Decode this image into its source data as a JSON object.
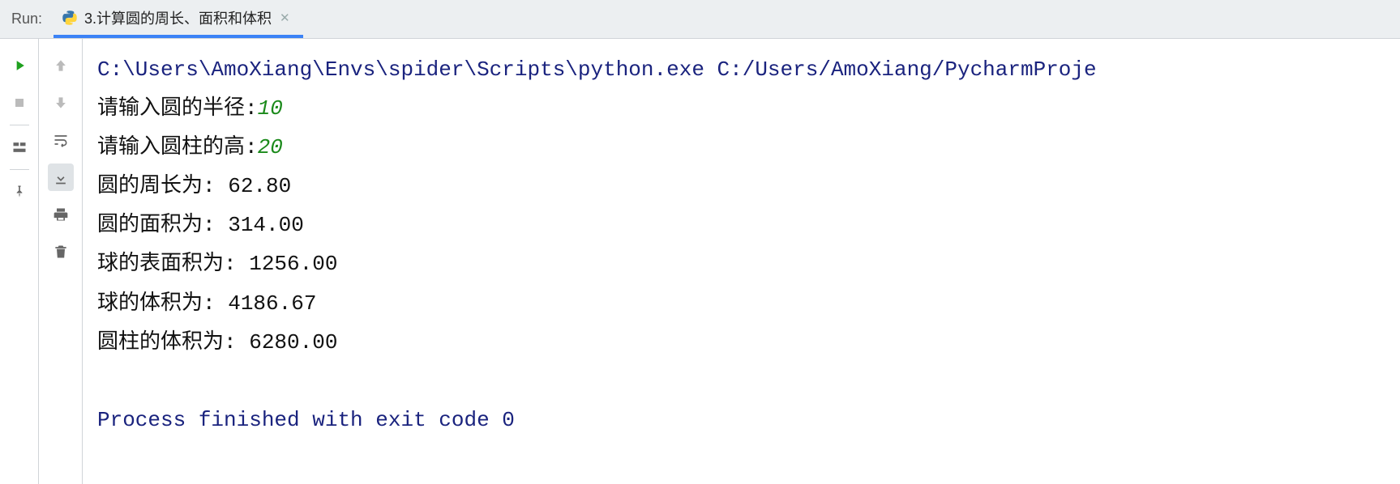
{
  "header": {
    "run_label": "Run:",
    "tab": {
      "title": "3.计算圆的周长、面积和体积"
    }
  },
  "left_buttons": {
    "run": "run",
    "stop": "stop",
    "layout": "layout",
    "pin": "pin"
  },
  "inner_buttons": {
    "up": "up",
    "down": "down",
    "wrap": "wrap",
    "scroll_end": "scroll-to-end",
    "print": "print",
    "delete": "delete"
  },
  "console": {
    "command": "C:\\Users\\AmoXiang\\Envs\\spider\\Scripts\\python.exe C:/Users/AmoXiang/PycharmProje",
    "prompt_radius": "请输入圆的半径:",
    "input_radius": "10",
    "prompt_height": "请输入圆柱的高:",
    "input_height": "20",
    "circumference_label": "圆的周长为: ",
    "circumference_value": "62.80",
    "area_label": "圆的面积为: ",
    "area_value": "314.00",
    "sphere_surface_label": "球的表面积为: ",
    "sphere_surface_value": "1256.00",
    "sphere_volume_label": "球的体积为: ",
    "sphere_volume_value": "4186.67",
    "cylinder_volume_label": "圆柱的体积为: ",
    "cylinder_volume_value": "6280.00",
    "exit_msg": "Process finished with exit code 0"
  }
}
